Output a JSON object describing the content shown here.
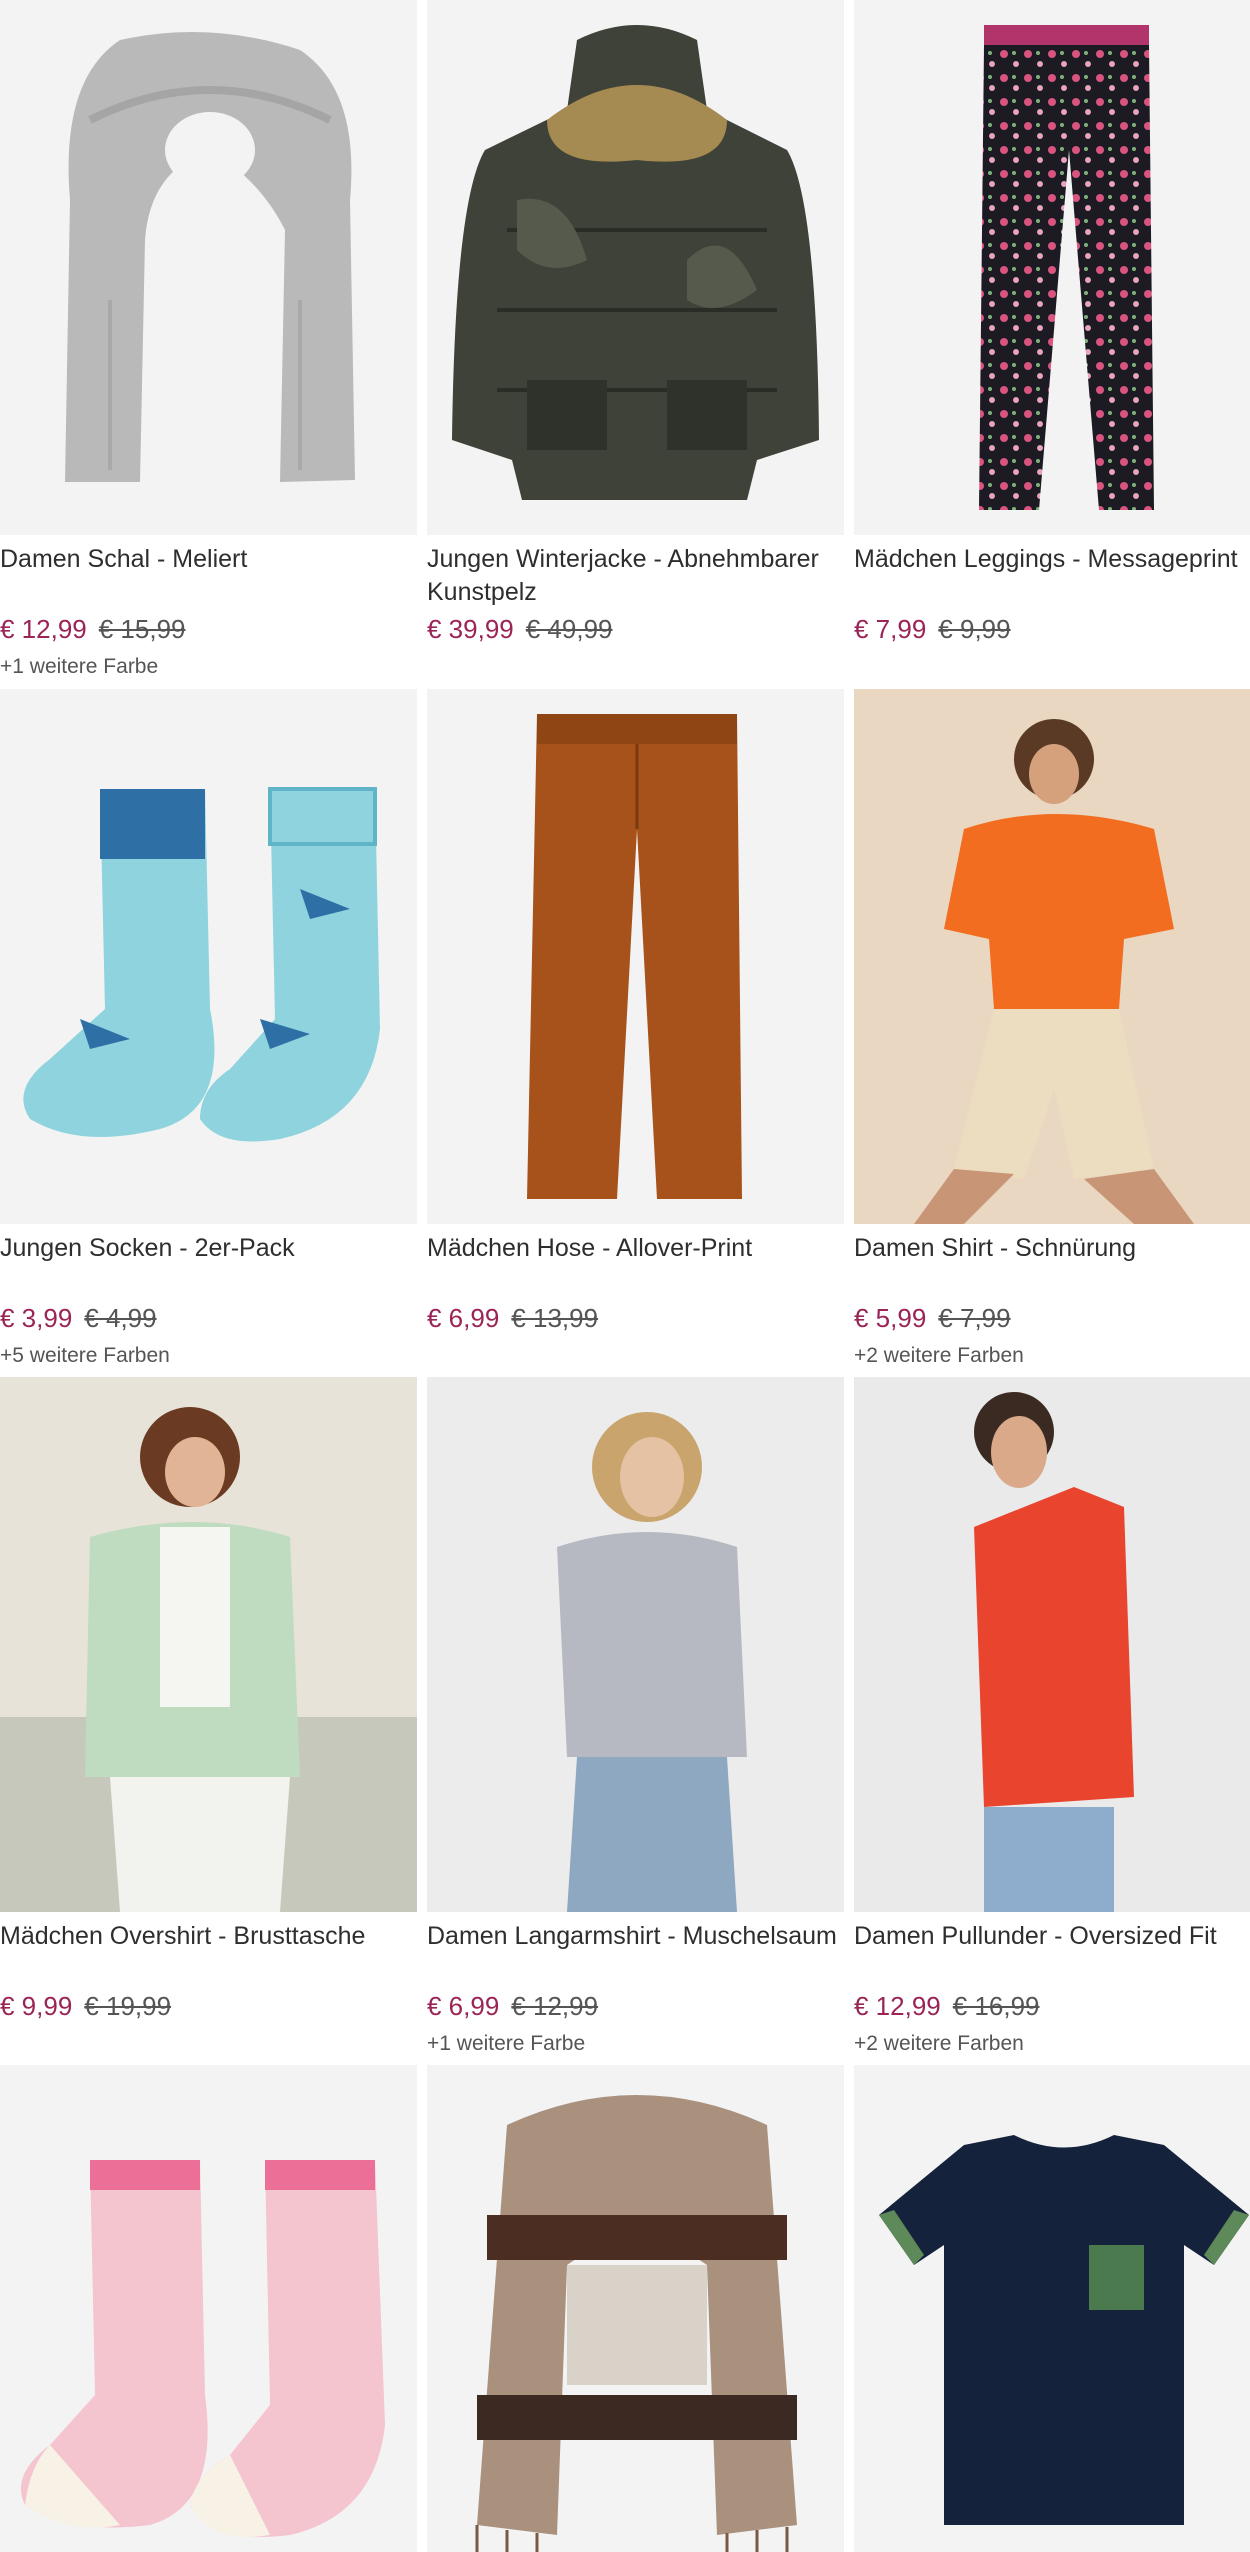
{
  "colors": {
    "price": "#9b2457",
    "old_price": "#555555",
    "title": "#2e2e2e"
  },
  "products": [
    {
      "title": "Damen Schal - Meliert",
      "price": "€ 12,99",
      "old_price": "€ 15,99",
      "more_colors": "+1 weitere Farbe",
      "image_icon": "grey-scarf"
    },
    {
      "title": "Jungen Winterjacke - Abnehmbarer Kunstpelz",
      "price": "€ 39,99",
      "old_price": "€ 49,99",
      "more_colors": "",
      "image_icon": "camo-winter-jacket"
    },
    {
      "title": "Mädchen Leggings - Messageprint",
      "price": "€ 7,99",
      "old_price": "€ 9,99",
      "more_colors": "",
      "image_icon": "floral-leggings"
    },
    {
      "title": "Jungen Socken - 2er-Pack",
      "price": "€ 3,99",
      "old_price": "€ 4,99",
      "more_colors": "+5 weitere Farben",
      "image_icon": "shark-socks"
    },
    {
      "title": "Mädchen Hose - Allover-Print",
      "price": "€ 6,99",
      "old_price": "€ 13,99",
      "more_colors": "",
      "image_icon": "rust-trousers"
    },
    {
      "title": "Damen Shirt - Schnürung",
      "price": "€ 5,99",
      "old_price": "€ 7,99",
      "more_colors": "+2 weitere Farben",
      "image_icon": "orange-shirt-model"
    },
    {
      "title": "Mädchen Overshirt - Brusttasche",
      "price": "€ 9,99",
      "old_price": "€ 19,99",
      "more_colors": "",
      "image_icon": "mint-overshirt-model"
    },
    {
      "title": "Damen Langarmshirt - Muschelsaum",
      "price": "€ 6,99",
      "old_price": "€ 12,99",
      "more_colors": "+1 weitere Farbe",
      "image_icon": "grey-longsleeve-model"
    },
    {
      "title": "Damen Pullunder - Oversized Fit",
      "price": "€ 12,99",
      "old_price": "€ 16,99",
      "more_colors": "+2 weitere Farben",
      "image_icon": "red-vest-model"
    },
    {
      "title": "",
      "price": "",
      "old_price": "",
      "more_colors": "",
      "image_icon": "pink-sloth-socks"
    },
    {
      "title": "",
      "price": "",
      "old_price": "",
      "more_colors": "",
      "image_icon": "checked-scarf"
    },
    {
      "title": "",
      "price": "",
      "old_price": "",
      "more_colors": "",
      "image_icon": "navy-tshirt-pocket"
    }
  ]
}
